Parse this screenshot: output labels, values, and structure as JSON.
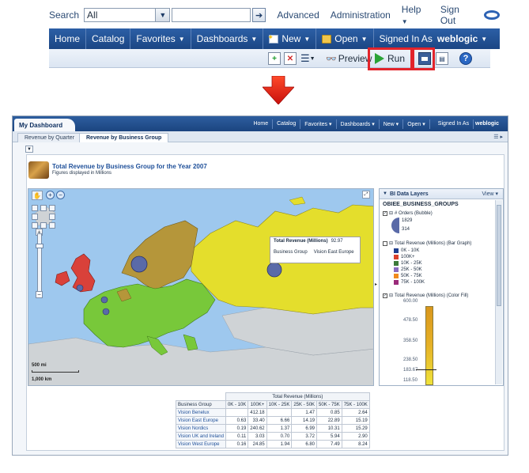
{
  "search": {
    "label": "Search",
    "scope_value": "All",
    "query_value": ""
  },
  "top_links": {
    "advanced": "Advanced",
    "administration": "Administration",
    "help": "Help",
    "sign_out": "Sign Out"
  },
  "nav": {
    "home": "Home",
    "catalog": "Catalog",
    "favorites": "Favorites",
    "dashboards": "Dashboards",
    "new": "New",
    "open": "Open",
    "signed_in_as": "Signed In As",
    "user": "weblogic"
  },
  "toolbar": {
    "preview": "Preview",
    "run": "Run"
  },
  "dashboard": {
    "title_tab": "My Dashboard",
    "nav": [
      "Home",
      "Catalog",
      "Favorites ▾",
      "Dashboards ▾",
      "New ▾",
      "Open ▾",
      "Signed In As"
    ],
    "user": "weblogic",
    "tabs": [
      "Revenue by Quarter",
      "Revenue by Business Group"
    ],
    "active_tab": "Revenue by Business Group",
    "report_title": "Total Revenue by Business Group for the Year 2007",
    "report_subtitle": "Figures displayed in Millions"
  },
  "map": {
    "scale_mi": "500 mi",
    "scale_km": "1,000 km",
    "tooltip": {
      "title": "Total Revenue (Millions)",
      "value": "92.97",
      "col1": "Business Group",
      "col2": "Vision East Europe"
    },
    "colors": {
      "sea": "#9ec8ee",
      "land_grey": "#cfd3d6",
      "red": "#d9413a",
      "green": "#78c83a",
      "olive": "#b5963a",
      "yellow": "#e4de2c",
      "bubble": "#5a6aa8"
    }
  },
  "data_layers": {
    "header": "BI Data Layers",
    "view": "View",
    "group": "OBIEE_BUSINESS_GROUPS",
    "layer1": "# Orders (Bubble)",
    "bubble_values": [
      "1829",
      "314"
    ],
    "layer2": "Total Revenue (Millions) (Bar Graph)",
    "bar_legend": [
      {
        "label": "0K - 10K",
        "color": "#1f3f8f"
      },
      {
        "label": "100K+",
        "color": "#d9412b"
      },
      {
        "label": "10K - 25K",
        "color": "#3d7a3a"
      },
      {
        "label": "25K - 50K",
        "color": "#8a6bbf"
      },
      {
        "label": "50K - 75K",
        "color": "#f08a1d"
      },
      {
        "label": "75K - 100K",
        "color": "#9a2a7a"
      }
    ],
    "layer3": "Total Revenue (Millions) (Color Fill)",
    "ramp_ticks": [
      "600.00",
      "478.50",
      "358.50",
      "238.50",
      "183.67",
      "118.50"
    ]
  },
  "table": {
    "caption": "Total Revenue (Millions)",
    "headers": [
      "Business Group",
      "0K - 10K",
      "100K+",
      "10K - 25K",
      "25K - 50K",
      "50K - 75K",
      "75K - 100K"
    ],
    "rows": [
      [
        "Vision Benelux",
        "",
        "412.18",
        "",
        "1.47",
        "0.85",
        "2.64"
      ],
      [
        "Vision East Europe",
        "0.63",
        "33.40",
        "6.66",
        "14.19",
        "22.89",
        "15.19"
      ],
      [
        "Vision Nordics",
        "0.19",
        "240.62",
        "1.37",
        "6.99",
        "10.31",
        "15.29"
      ],
      [
        "Vision UK and Ireland",
        "0.11",
        "3.03",
        "0.70",
        "3.72",
        "5.94",
        "2.90"
      ],
      [
        "Vision West Europe",
        "0.16",
        "24.85",
        "1.94",
        "6.80",
        "7.49",
        "8.24"
      ]
    ]
  }
}
